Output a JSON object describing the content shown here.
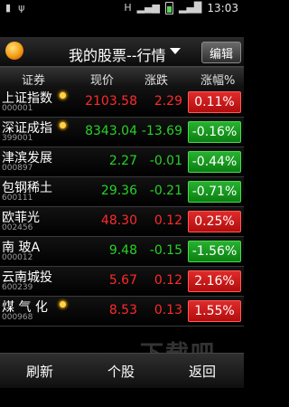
{
  "statusbar": {
    "time": "13:03"
  },
  "titlebar": {
    "logo_text": "",
    "title": "我的股票--行情",
    "edit_label": "编辑"
  },
  "header": {
    "col_name": "证券",
    "col_price": "现价",
    "col_change": "涨跌",
    "col_pct": "涨幅%"
  },
  "stocks": [
    {
      "name": "上证指数",
      "code": "000001",
      "price": "2103.58",
      "change": "2.29",
      "pct": "0.11%",
      "dir": "up",
      "sun": true
    },
    {
      "name": "深证成指",
      "code": "399001",
      "price": "8343.04",
      "change": "-13.69",
      "pct": "-0.16%",
      "dir": "down",
      "sun": true
    },
    {
      "name": "津滨发展",
      "code": "000897",
      "price": "2.27",
      "change": "-0.01",
      "pct": "-0.44%",
      "dir": "down",
      "sun": false
    },
    {
      "name": "包钢稀土",
      "code": "600111",
      "price": "29.36",
      "change": "-0.21",
      "pct": "-0.71%",
      "dir": "down",
      "sun": false
    },
    {
      "name": "欧菲光",
      "code": "002456",
      "price": "48.30",
      "change": "0.12",
      "pct": "0.25%",
      "dir": "up",
      "sun": false
    },
    {
      "name": "南 玻A",
      "code": "000012",
      "price": "9.48",
      "change": "-0.15",
      "pct": "-1.56%",
      "dir": "down",
      "sun": false
    },
    {
      "name": "云南城投",
      "code": "600239",
      "price": "5.67",
      "change": "0.12",
      "pct": "2.16%",
      "dir": "up",
      "sun": false
    },
    {
      "name": "煤 气 化",
      "code": "000968",
      "price": "8.53",
      "change": "0.13",
      "pct": "1.55%",
      "dir": "up",
      "sun": true
    }
  ],
  "bottom": {
    "refresh": "刷新",
    "stock": "个股",
    "back": "返回"
  },
  "watermark": "下载吧",
  "colors": {
    "up": "#ff2a2a",
    "down": "#27d227"
  }
}
